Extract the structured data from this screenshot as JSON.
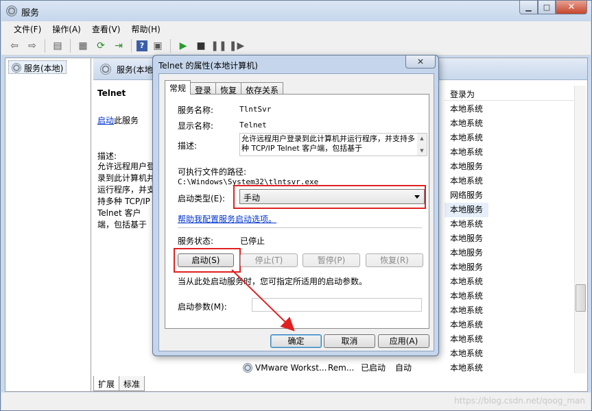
{
  "window": {
    "title": "服务"
  },
  "menu": [
    "文件(F)",
    "操作(A)",
    "查看(V)",
    "帮助(H)"
  ],
  "tree": {
    "root_label": "服务(本地)"
  },
  "pane": {
    "header_title": "服务(本地",
    "service_name": "Telnet",
    "start_link": "启动",
    "start_suffix": "此服务",
    "desc_label": "描述:",
    "desc_text": "允许远程用户登录到此计算机并运行程序，并支持多种 TCP/IP Telnet 客户端，包括基于 UNIX 和 Windows 的计算机。如果此服务停止，远程用户就不能访问程序，任何直接依赖于它的服务将会启动失败。",
    "logon_header": "登录为",
    "logon_list": [
      "本地系统",
      "本地系统",
      "本地系统",
      "本地系统",
      "本地服务",
      "本地系统",
      "网络服务",
      "本地服务",
      "本地系统",
      "本地服务",
      "本地服务",
      "本地服务",
      "本地系统",
      "本地系统",
      "本地系统",
      "本地系统",
      "本地系统",
      "本地系统",
      "本地系统"
    ],
    "vm_row": {
      "name": "VMware Workst...",
      "desc": "Rem...",
      "status": "已启动",
      "type": "自动"
    },
    "tabs": [
      "扩展",
      "标准"
    ]
  },
  "dialog": {
    "title": "Telnet 的属性(本地计算机)",
    "close": "✕",
    "tabs": [
      "常规",
      "登录",
      "恢复",
      "依存关系"
    ],
    "service_name_label": "服务名称:",
    "service_name": "TlntSvr",
    "display_name_label": "显示名称:",
    "display_name": "Telnet",
    "desc_label": "描述:",
    "desc_text": "允许远程用户登录到此计算机并运行程序，并支持多种 TCP/IP Telnet 客户端，包括基于",
    "exe_path_label": "可执行文件的路径:",
    "exe_path": "C:\\Windows\\System32\\tlntsvr.exe",
    "startup_type_label": "启动类型(E):",
    "startup_type": "手动",
    "help_link": "帮助我配置服务启动选项。",
    "status_label": "服务状态:",
    "status_value": "已停止",
    "btn_start": "启动(S)",
    "btn_stop": "停止(T)",
    "btn_pause": "暂停(P)",
    "btn_resume": "恢复(R)",
    "start_hint": "当从此处启动服务时，您可指定所适用的启动参数。",
    "param_label": "启动参数(M):",
    "param_value": "",
    "btn_ok": "确定",
    "btn_cancel": "取消",
    "btn_apply": "应用(A)"
  },
  "watermark": "https://blog.csdn.net/qoog_man",
  "colors": {
    "highlight": "#e02020",
    "link": "#0033cc"
  }
}
